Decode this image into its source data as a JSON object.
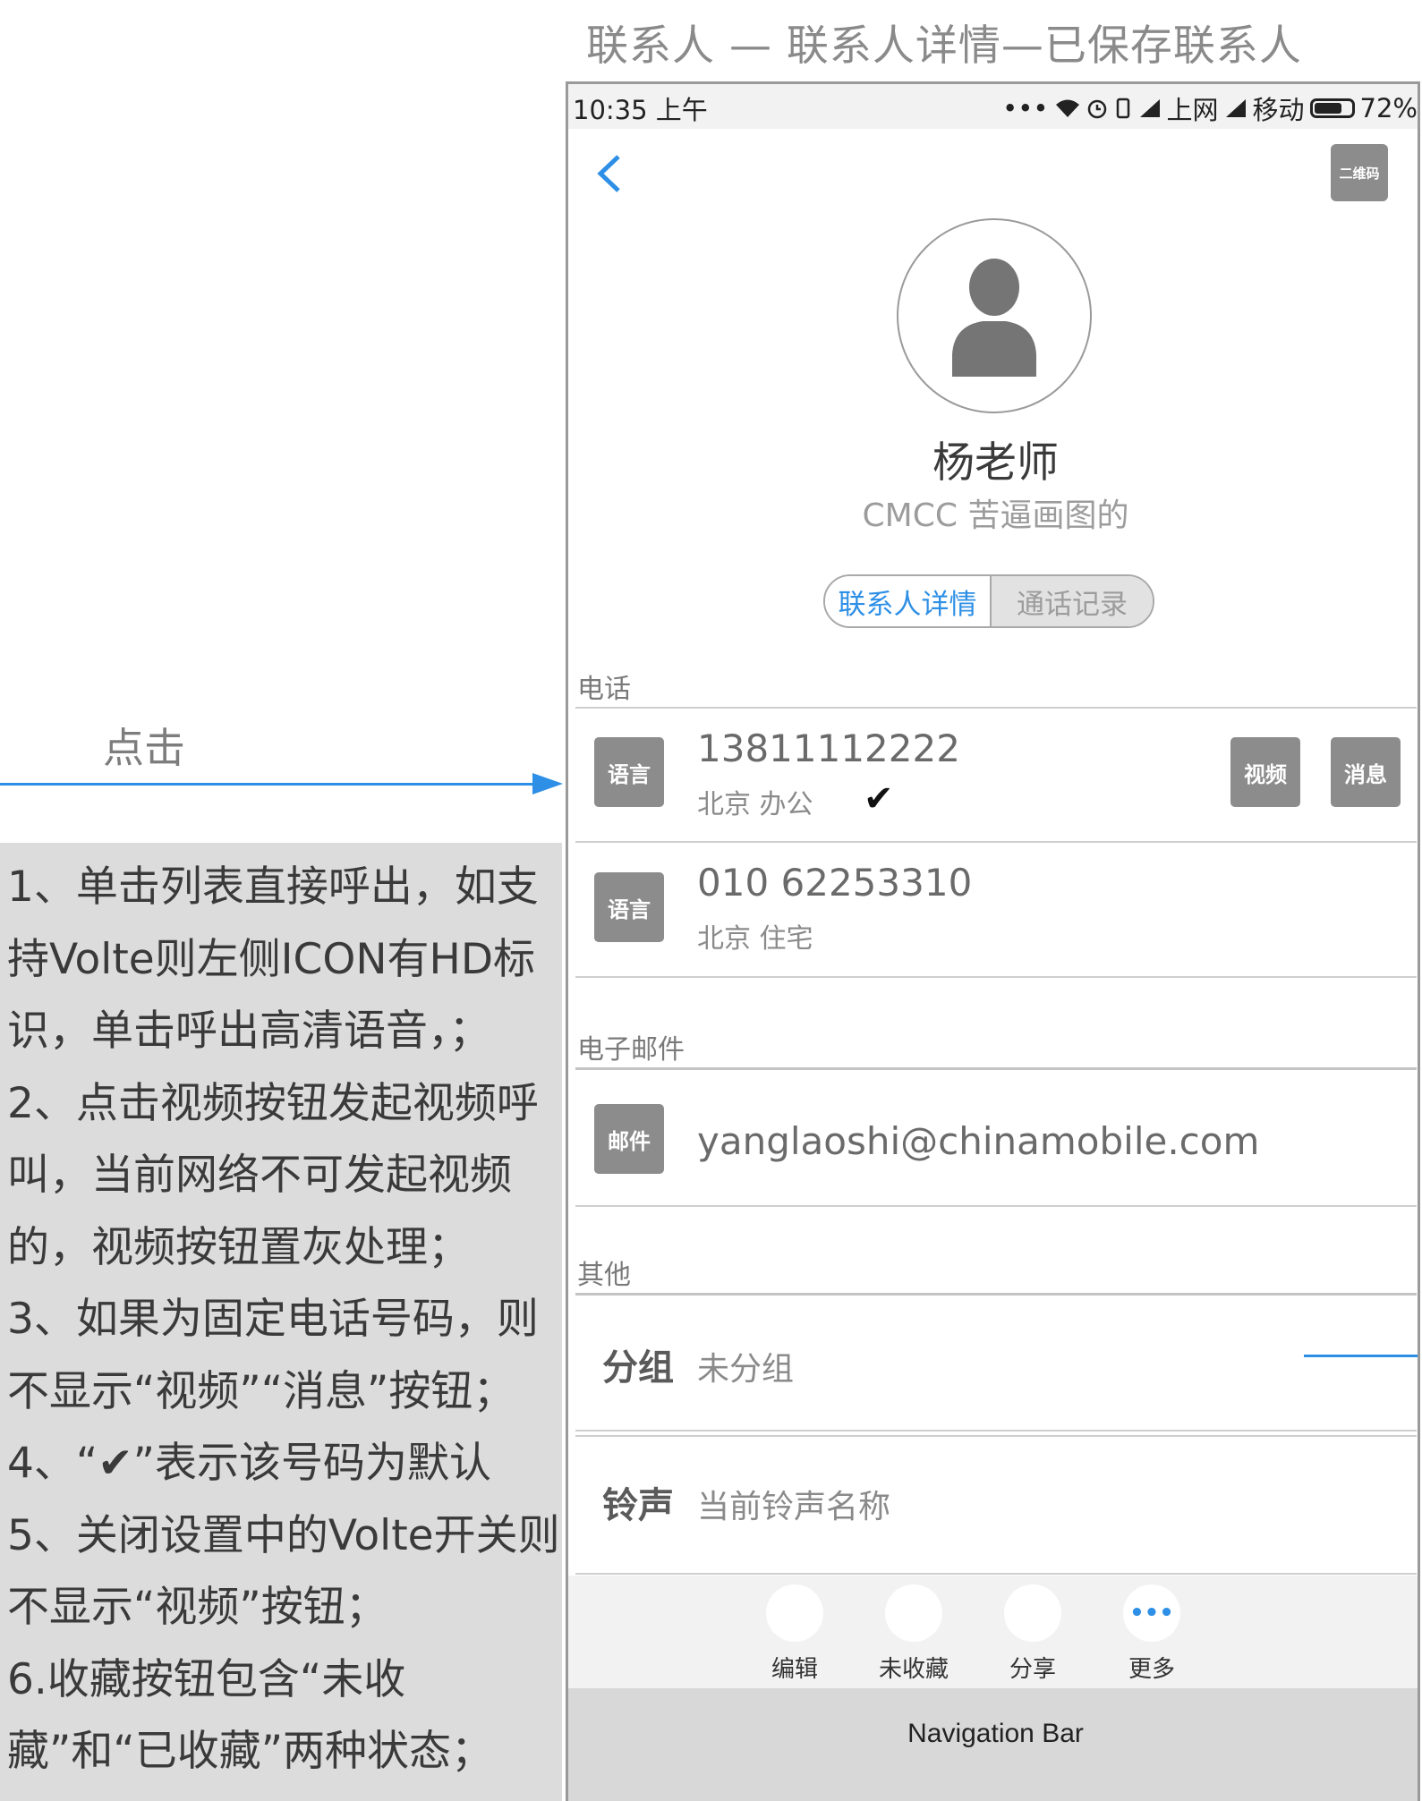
{
  "page_title": "联系人 — 联系人详情—已保存联系人",
  "annotation": {
    "click_label": "点击",
    "notes": [
      "1、单击列表直接呼出，如支",
      "持Volte则左侧ICON有HD标",
      "识，单击呼出高清语音，；",
      "2、点击视频按钮发起视频呼",
      "叫，当前网络不可发起视频",
      "的，视频按钮置灰处理；",
      "3、如果为固定电话号码，则",
      "不显示“视频”“消息”按钮；",
      "4、“✔”表示该号码为默认",
      "5、关闭设置中的Volte开关则",
      "不显示“视频”按钮；",
      "6.收藏按钮包含“未收",
      "藏”和“已收藏”两种状态；"
    ]
  },
  "status_bar": {
    "time": "10:35 上午",
    "dots": "•••",
    "net1": "上网",
    "net2": "移动",
    "battery": "72%"
  },
  "header": {
    "qr_label": "二维码"
  },
  "contact": {
    "name": "杨老师",
    "org": "CMCC  苦逼画图的"
  },
  "tabs": {
    "details": "联系人详情",
    "calls": "通话记录"
  },
  "phone_section": {
    "label": "电话",
    "entries": [
      {
        "tag": "语言",
        "number": "13811112222",
        "location": "北京  办公",
        "default_mark": "✔",
        "video": "视频",
        "message": "消息"
      },
      {
        "tag": "语言",
        "number": "010 62253310",
        "location": "北京  住宅"
      }
    ]
  },
  "email_section": {
    "label": "电子邮件",
    "tag": "邮件",
    "address": "yanglaoshi@chinamobile.com"
  },
  "other_section": {
    "label": "其他",
    "group_title": "分组",
    "group_value": "未分组",
    "ringtone_title": "铃声",
    "ringtone_value": "当前铃声名称"
  },
  "toolbar": {
    "edit": "编辑",
    "favorite": "未收藏",
    "share": "分享",
    "more": "更多",
    "more_glyph": "•••"
  },
  "navigation_bar": "Navigation Bar",
  "colors": {
    "accent": "#2e8fe6",
    "tag_gray": "#8c8c8c",
    "notes_bg": "#dcdcdc"
  }
}
